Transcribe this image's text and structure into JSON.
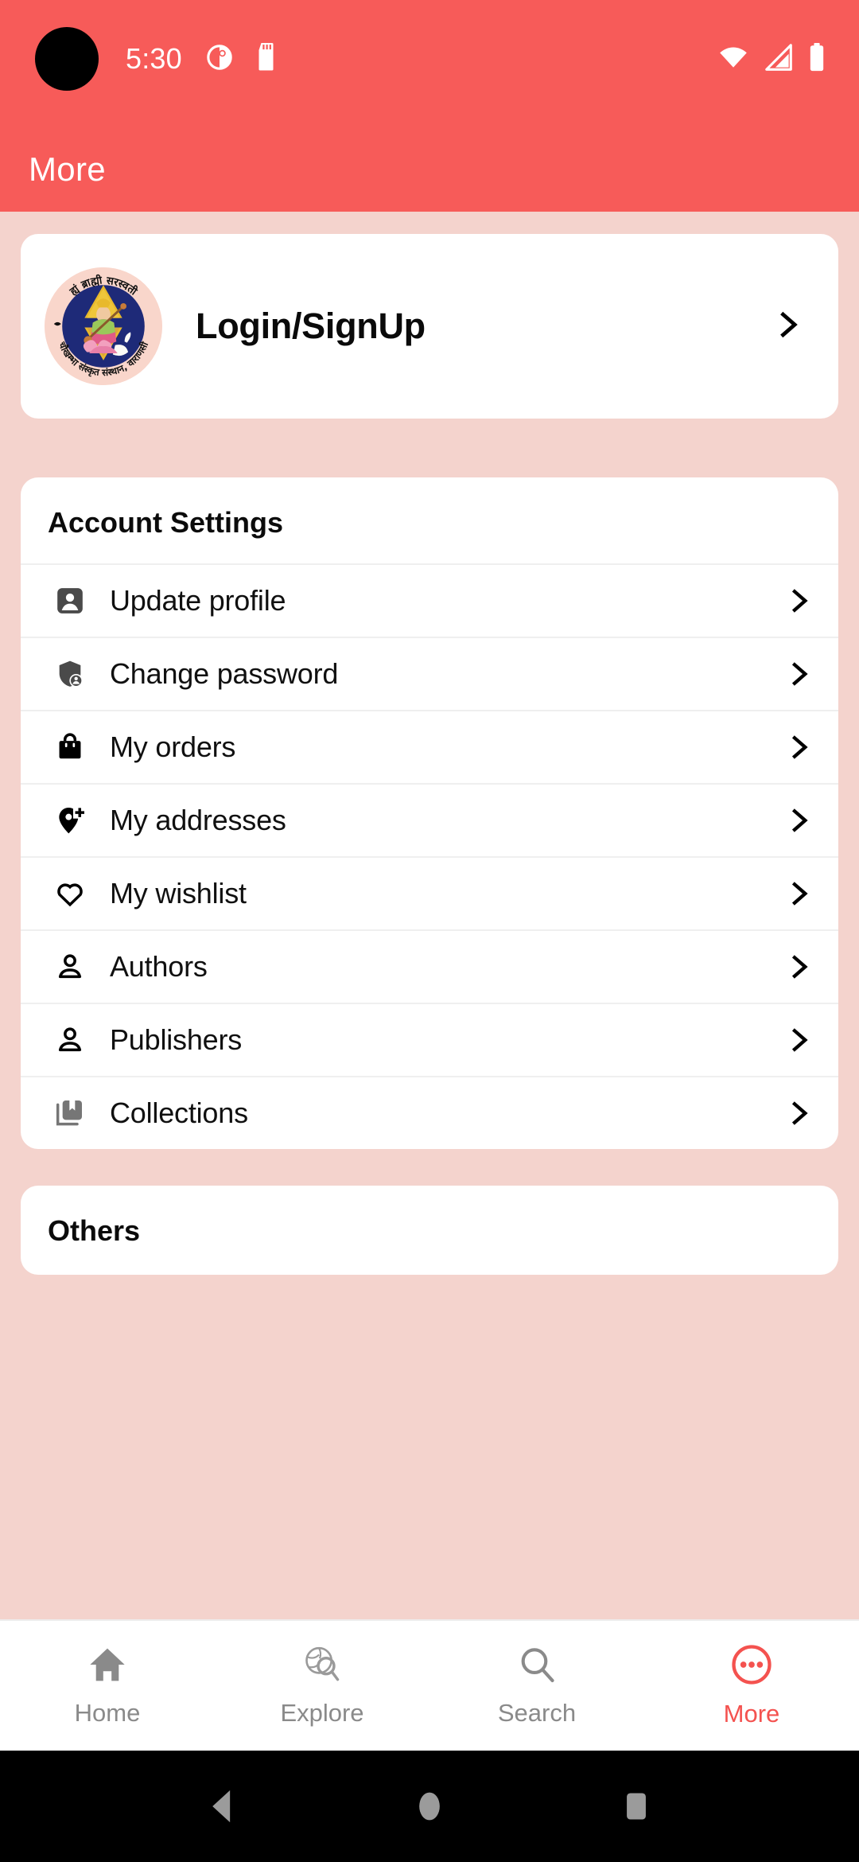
{
  "statusbar": {
    "time": "5:30",
    "icons_left": [
      "contacts-sync-icon",
      "sd-card-icon"
    ],
    "icons_right": [
      "wifi-icon",
      "cellular-signal-icon",
      "battery-icon"
    ],
    "background_color": "#F75B59"
  },
  "appbar": {
    "title": "More",
    "background_color": "#F75B59",
    "title_color": "#FFFFFF"
  },
  "theme": {
    "page_background": "#F4D3CD",
    "card_background": "#FFFFFF",
    "accent": "#F4524F",
    "divider": "#EFEFEF"
  },
  "login_card": {
    "logo_name": "saraswati-emblem-logo",
    "logo_top_text": "ह्यं ब्राह्मी सरस्वती",
    "logo_bottom_text": "चौखम्भा संस्कृत संस्थान, वाराणसी",
    "label": "Login/SignUp",
    "chevron": "chevron-right-icon"
  },
  "account_settings": {
    "title": "Account Settings",
    "items": [
      {
        "label": "Update profile",
        "icon": "account-box-icon"
      },
      {
        "label": "Change password",
        "icon": "shield-person-icon"
      },
      {
        "label": "My orders",
        "icon": "shopping-bag-icon"
      },
      {
        "label": "My addresses",
        "icon": "add-location-icon"
      },
      {
        "label": "My wishlist",
        "icon": "heart-outline-icon"
      },
      {
        "label": "Authors",
        "icon": "person-outline-icon"
      },
      {
        "label": "Publishers",
        "icon": "person-outline-icon"
      },
      {
        "label": "Collections",
        "icon": "collections-bookmark-icon"
      }
    ]
  },
  "others": {
    "title": "Others"
  },
  "bottom_nav": {
    "items": [
      {
        "label": "Home",
        "icon": "home-icon",
        "active": false
      },
      {
        "label": "Explore",
        "icon": "explore-icon",
        "active": false
      },
      {
        "label": "Search",
        "icon": "search-icon",
        "active": false
      },
      {
        "label": "More",
        "icon": "more-dots-icon",
        "active": true
      }
    ]
  },
  "android_nav": {
    "buttons": [
      "back-button",
      "home-button",
      "recents-button"
    ]
  }
}
